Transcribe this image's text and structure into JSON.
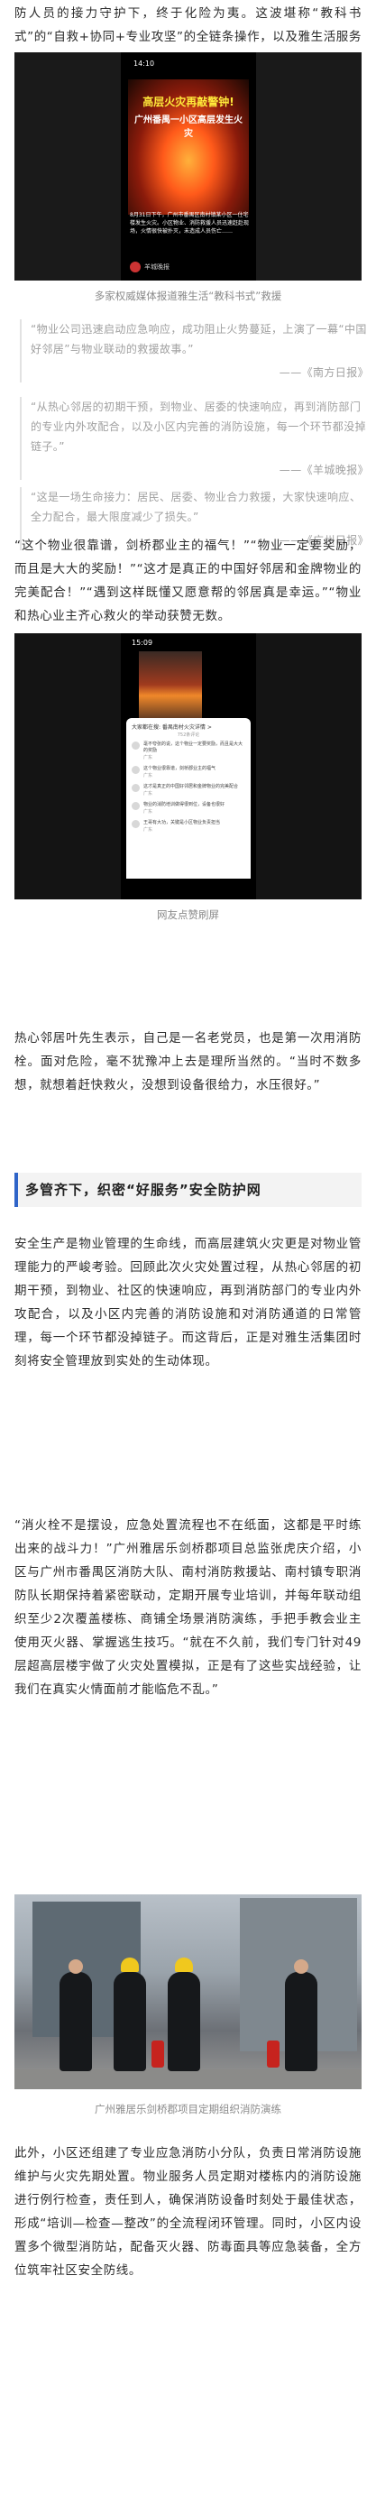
{
  "para_intro": "防人员的接力守护下，终于化险为夷。这波堪称“教科书式”的“自救+协同+专业攻坚”的全链条操作，以及雅生活服务团队在救援过程中展现的专业素养、对消防设备的常态化维护在网络广为传播，引发多家权威媒体和网民纷纷点赞！",
  "photo1": {
    "time": "14:10",
    "overlay_line1": "高层火灾再敲警钟!",
    "overlay_line2": "广州番禺一小区高层发生火灾",
    "overlay_body": "8月31日下午，广州市番禺区南村镇某小区一住宅楼发生火灾。小区物业、消防救援人员迅速赶赴现场，火情很快被扑灭，未造成人员伤亡……",
    "account": "羊城晚报",
    "caption": "多家权威媒体报道雅生活“教科书式”救援"
  },
  "quotes": [
    {
      "text": "“物业公司迅速启动应急响应，成功阻止火势蔓延，上演了一幕“中国好邻居”与物业联动的救援故事。”",
      "source": "——《南方日报》"
    },
    {
      "text": "“从热心邻居的初期干预，到物业、居委的快速响应，再到消防部门的专业内外攻配合，以及小区内完善的消防设施，每一个环节都没掉链子。”",
      "source": "——《羊城晚报》"
    },
    {
      "text": "“这是一场生命接力：居民、居委、物业合力救援，大家快速响应、全力配合，最大限度减少了损失。”",
      "source": "——《广州日报》"
    }
  ],
  "para_netizens": "“这个物业很靠谱，剑桥郡业主的福气！”“物业一定要奖励，而且是大大的奖励！”“这才是真正的中国好邻居和金牌物业的完美配合！”“遇到这样既懂又愿意帮的邻居真是幸运。”“物业和热心业主齐心救火的举动获赞无数。",
  "photo2": {
    "time": "15:09",
    "sheet_title": "大家都在搜: 番禺南村火灾详情 >",
    "sheet_count": "752条评论",
    "comments": [
      {
        "text": "毫不夸张的说，这个物业一定要奖励，而且是大大的奖励",
        "meta": "广东"
      },
      {
        "text": "这个物业很靠谱，剑桥郡业主的福气",
        "meta": "广东"
      },
      {
        "text": "这才是真正的中国好邻居和金牌物业的完美配合",
        "meta": "广东"
      },
      {
        "text": "物业的消防培训做得很到位，设备也很好",
        "meta": "广东"
      },
      {
        "text": "王哥有大功，关键是小区物业负责担当",
        "meta": "广东"
      }
    ],
    "caption": "网友点赞刷屏"
  },
  "para_neighbor": "热心邻居叶先生表示，自己是一名老党员，也是第一次用消防栓。面对危险，毫不犹豫冲上去是理所当然的。“当时不数多想，就想着赶快救火，没想到设备很给力，水压很好。”",
  "section_title": "多管齐下，织密“好服务”安全防护网",
  "para_safety": "安全生产是物业管理的生命线，而高层建筑火灾更是对物业管理能力的严峻考验。回顾此次火灾处置过程，从热心邻居的初期干预，到物业、社区的快速响应，再到消防部门的专业内外攻配合，以及小区内完善的消防设施和对消防通道的日常管理，每一个环节都没掉链子。而这背后，正是对雅生活集团时刻将安全管理放到实处的生动体现。",
  "para_drill": "“消火栓不是摆设，应急处置流程也不在纸面，这都是平时练出来的战斗力！”广州雅居乐剑桥郡项目总监张虎庆介绍，小区与广州市番禺区消防大队、南村消防救援站、南村镇专职消防队长期保持着紧密联动，定期开展专业培训，并每年联动组织至少2次覆盖楼栋、商铺全场景消防演练，手把手教会业主使用灭火器、掌握逃生技巧。“就在不久前，我们专门针对49层超高层楼宇做了火灾处置模拟，正是有了这些实战经验，让我们在真实火情面前才能临危不乱。”",
  "photo3": {
    "caption": "广州雅居乐剑桥郡项目定期组织消防演练"
  },
  "para_final": "此外，小区还组建了专业应急消防小分队，负责日常消防设施维护与火灾先期处置。物业服务人员定期对楼栋内的消防设施进行例行检查，责任到人，确保消防设备时刻处于最佳状态，形成“培训—检查—整改”的全流程闭环管理。同时，小区内设置多个微型消防站，配备灭火器、防毒面具等应急装备，全方位筑牢社区安全防线。"
}
